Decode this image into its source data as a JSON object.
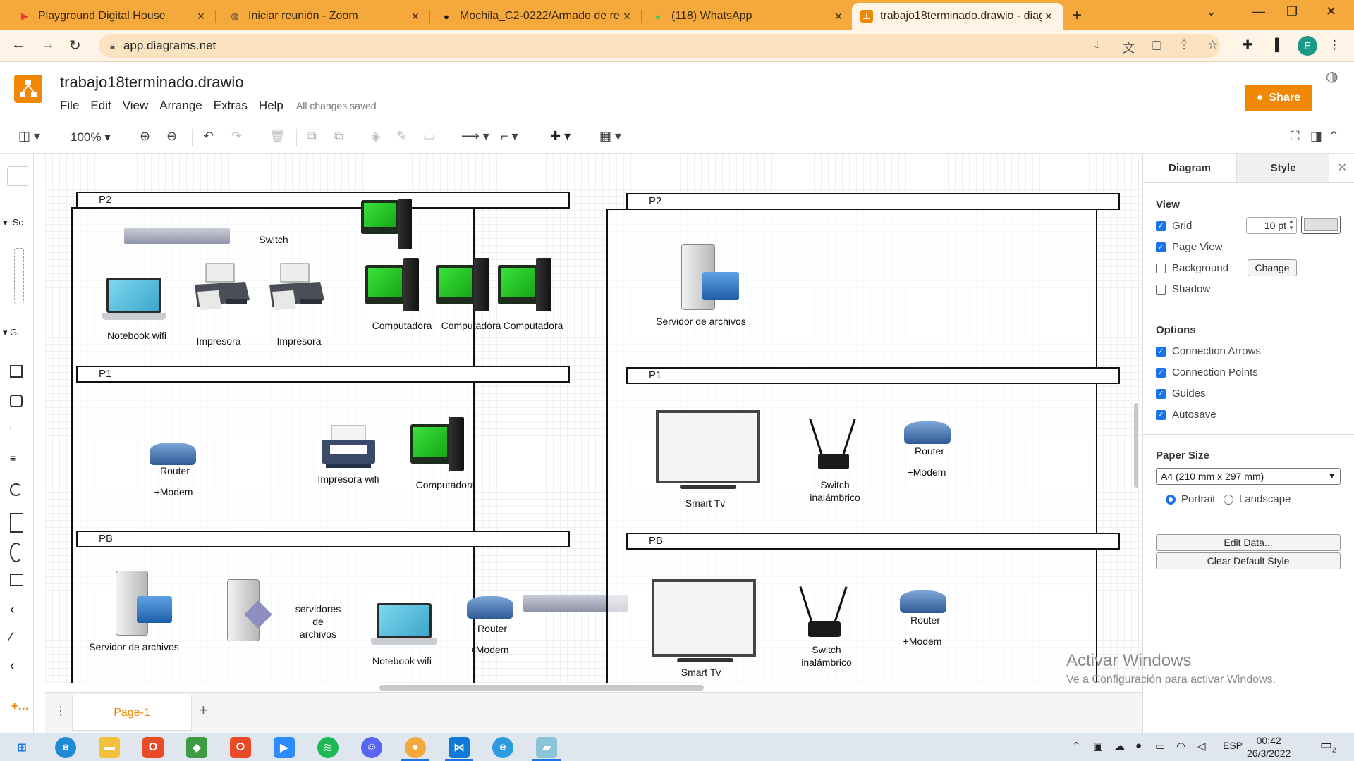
{
  "browser": {
    "tabs": [
      {
        "title": "Playground Digital House",
        "icon": "play-icon",
        "color": "#e53935"
      },
      {
        "title": "Iniciar reunión - Zoom",
        "icon": "globe-icon",
        "color": "#444444"
      },
      {
        "title": "Mochila_C2-0222/Armado de re",
        "icon": "github-icon",
        "color": "#111111"
      },
      {
        "title": "(118) WhatsApp",
        "icon": "whatsapp-icon",
        "color": "#25d366"
      },
      {
        "title": "trabajo18terminado.drawio - diag",
        "icon": "drawio-icon",
        "color": "#f08705"
      }
    ],
    "address": "app.diagrams.net",
    "profile_initial": "E"
  },
  "app": {
    "doc_title": "trabajo18terminado.drawio",
    "menu": [
      "File",
      "Edit",
      "View",
      "Arrange",
      "Extras",
      "Help"
    ],
    "save_status": "All changes saved",
    "share_label": "Share",
    "zoom": "100%",
    "brand_color": "#f08705"
  },
  "left_building": {
    "floors": [
      "P2",
      "P1",
      "PB"
    ],
    "p2": {
      "switch": "Switch",
      "notebook": "Notebook wifi",
      "printer1": "Impresora",
      "printer2": "Impresora",
      "pc1": "Computadora",
      "pc2": "Computadora",
      "pc3": "Computadora"
    },
    "p1": {
      "router": "Router",
      "modem": "+Modem",
      "printer": "Impresora wifi",
      "pc": "Computadora"
    },
    "pb": {
      "server": "Servidor de archivos",
      "servers_l1": "servidores",
      "servers_l2": "de",
      "servers_l3": "archivos",
      "notebook": "Notebook wifi",
      "router": "Router",
      "modem": "+Modem"
    }
  },
  "right_building": {
    "floors": [
      "P2",
      "P1",
      "PB"
    ],
    "p2": {
      "server": "Servidor de archivos"
    },
    "p1": {
      "tv": "Smart Tv",
      "switch_l1": "Switch",
      "switch_l2": "inalámbrico",
      "router": "Router",
      "modem": "+Modem"
    },
    "pb": {
      "tv": "Smart Tv",
      "switch_l1": "Switch",
      "switch_l2": "inalámbrico",
      "router": "Router",
      "modem": "+Modem"
    }
  },
  "pages": {
    "current": "Page-1"
  },
  "panel": {
    "tabs": [
      "Diagram",
      "Style"
    ],
    "view_title": "View",
    "grid_label": "Grid",
    "grid_size": "10 pt",
    "page_view_label": "Page View",
    "background_label": "Background",
    "change_label": "Change",
    "shadow_label": "Shadow",
    "options_title": "Options",
    "options": [
      "Connection Arrows",
      "Connection Points",
      "Guides",
      "Autosave"
    ],
    "paper_title": "Paper Size",
    "paper_value": "A4 (210 mm x 297 mm)",
    "portrait": "Portrait",
    "landscape": "Landscape",
    "edit_data": "Edit Data...",
    "clear_style": "Clear Default Style"
  },
  "watermark": {
    "line1": "Activar Windows",
    "line2": "Ve a Configuración para activar Windows."
  },
  "taskbar": {
    "lang": "ESP",
    "time": "00:42",
    "date": "26/3/2022",
    "notifications": "2"
  }
}
